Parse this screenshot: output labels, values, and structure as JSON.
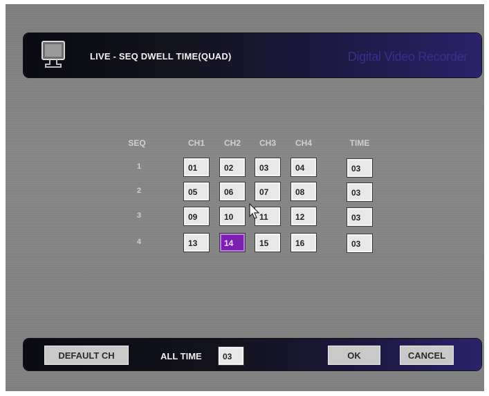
{
  "title_bar": {
    "title": "LIVE - SEQ DWELL TIME(QUAD)",
    "brand": "Digital Video Recorder",
    "icon": "monitor-icon"
  },
  "grid": {
    "headers": {
      "seq": "SEQ",
      "ch1": "CH1",
      "ch2": "CH2",
      "ch3": "CH3",
      "ch4": "CH4",
      "time": "TIME"
    },
    "rows": [
      {
        "seq": "1",
        "ch1": "01",
        "ch2": "02",
        "ch3": "03",
        "ch4": "04",
        "time": "03"
      },
      {
        "seq": "2",
        "ch1": "05",
        "ch2": "06",
        "ch3": "07",
        "ch4": "08",
        "time": "03"
      },
      {
        "seq": "3",
        "ch1": "09",
        "ch2": "10",
        "ch3": "11",
        "ch4": "12",
        "time": "03"
      },
      {
        "seq": "4",
        "ch1": "13",
        "ch2": "14",
        "ch3": "15",
        "ch4": "16",
        "time": "03"
      }
    ],
    "selected_cell": "row 4, CH2",
    "selected_color": "#7a1fb0"
  },
  "bottom_bar": {
    "default_ch_label": "DEFAULT CH",
    "all_time_label": "ALL TIME",
    "all_time_value": "03",
    "ok_label": "OK",
    "cancel_label": "CANCEL"
  },
  "colors": {
    "background": "#808080",
    "bar_dark": "#13131e",
    "bar_accent": "#2a236a",
    "brand_text": "#3b2f8e"
  }
}
